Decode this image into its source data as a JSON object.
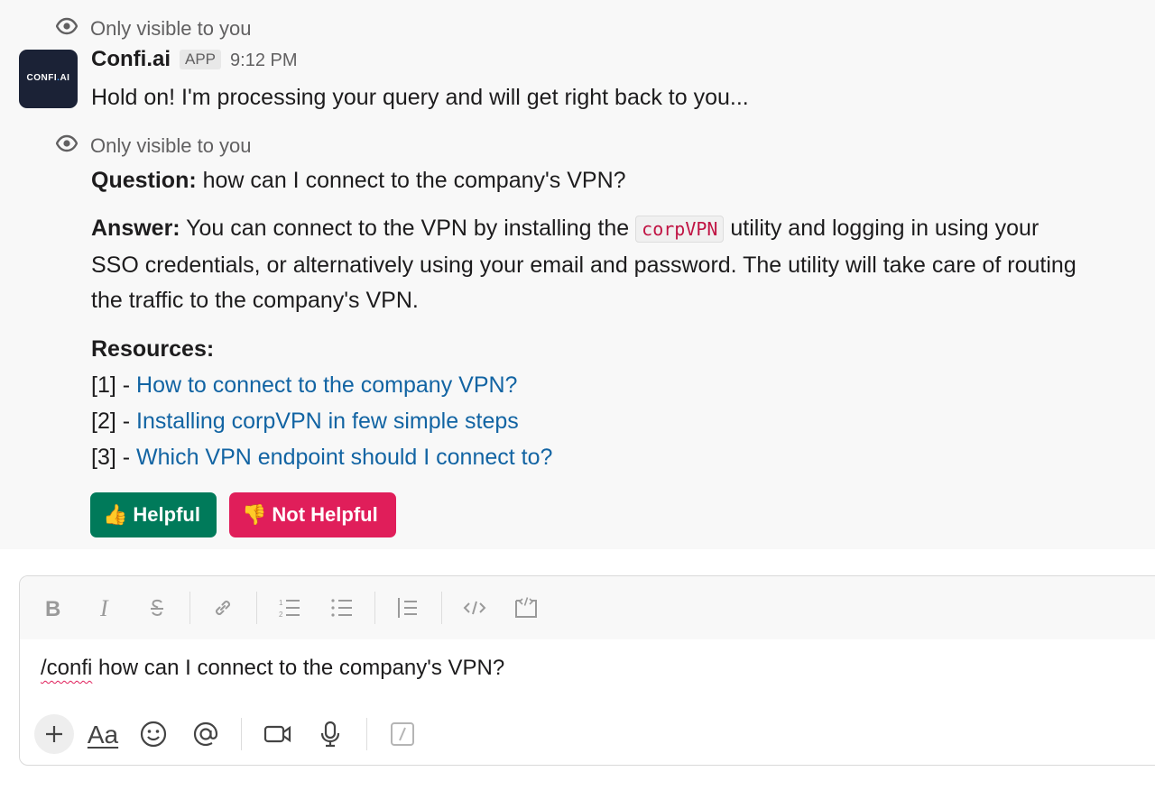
{
  "visibility_note": "Only visible to you",
  "message1": {
    "sender": "Confi.ai",
    "badge": "APP",
    "time": "9:12 PM",
    "text": "Hold on! I'm processing your query and will get right back to you..."
  },
  "avatar": {
    "logo_main": "CONFI",
    "logo_dot": ".",
    "logo_end": "AI"
  },
  "message2": {
    "question_label": "Question:",
    "question_text": " how can I connect to the company's VPN?",
    "answer_label": "Answer:",
    "answer_pre": " You can connect to the VPN by installing the ",
    "answer_code": "corpVPN",
    "answer_post": " utility and logging in using your SSO credentials, or alternatively using your email and password. The utility will take care of routing the traffic to the company's VPN.",
    "resources_label": "Resources:",
    "resources": [
      {
        "prefix": "[1] - ",
        "title": "How to connect to the company VPN?"
      },
      {
        "prefix": "[2] - ",
        "title": "Installing corpVPN in few simple steps"
      },
      {
        "prefix": "[3] - ",
        "title": "Which VPN endpoint should I connect to?"
      }
    ],
    "buttons": {
      "helpful": {
        "emoji": "👍",
        "label": "Helpful",
        "color": "#007a5a"
      },
      "not_helpful": {
        "emoji": "👎",
        "label": "Not Helpful",
        "color": "#e01e5a"
      }
    }
  },
  "composer": {
    "command": "/confi",
    "text": " how can I connect to the company's VPN?",
    "formatting_icons": [
      "bold-icon",
      "italic-icon",
      "strikethrough-icon",
      "link-icon",
      "ordered-list-icon",
      "bullet-list-icon",
      "blockquote-icon",
      "code-icon",
      "code-block-icon"
    ],
    "bottom_icons": [
      "plus-icon",
      "text-format-icon",
      "emoji-icon",
      "mention-icon",
      "video-icon",
      "microphone-icon",
      "slash-shortcut-icon"
    ],
    "aa_label": "Aa"
  }
}
